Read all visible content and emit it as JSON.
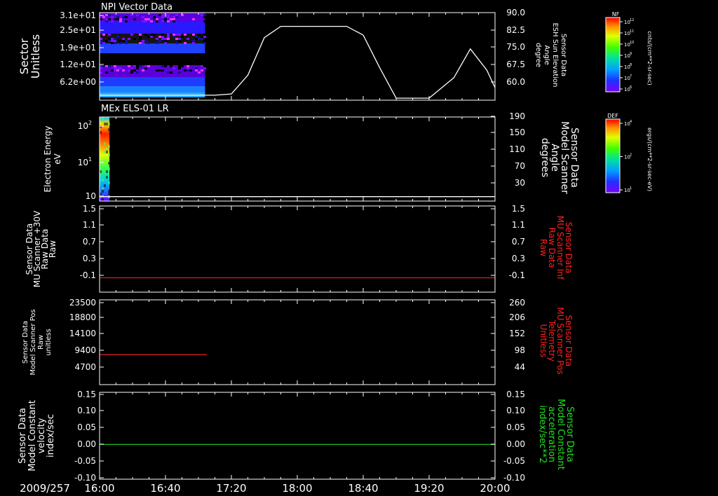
{
  "chart_data": {
    "date_label": "2009/257",
    "time_axis": {
      "start": "16:00",
      "end": "20:00",
      "tick_labels": [
        "16:00",
        "16:40",
        "17:20",
        "18:00",
        "18:40",
        "19:20",
        "20:00"
      ]
    },
    "panels": [
      {
        "id": "p1",
        "type": "heatmap",
        "title": "NPI Vector Data",
        "left_axis": {
          "label_lines": [
            "Sector",
            "Unitless"
          ],
          "tick_labels": [
            "3.1e+01",
            "2.5e+01",
            "1.9e+01",
            "1.2e+01",
            "6.2e+00"
          ],
          "range": [
            0,
            31
          ]
        },
        "right_axis": {
          "label_lines": [
            "Sensor Data",
            "ESH Sun Elevation",
            "Angle",
            "degree"
          ],
          "tick_labels": [
            "90.0",
            "82.5",
            "75.0",
            "67.5",
            "60.0"
          ],
          "range": [
            55,
            90
          ],
          "color": "#ffffff"
        },
        "heatmap_extent": {
          "x": [
            "16:00",
            "17:04"
          ]
        },
        "line_series": {
          "name": "ESH Sun Elevation Angle",
          "color": "#ffffff",
          "points": [
            [
              "16:00",
              57.0
            ],
            [
              "17:10",
              57.0
            ],
            [
              "17:20",
              57.5
            ],
            [
              "17:30",
              65
            ],
            [
              "17:40",
              80
            ],
            [
              "17:50",
              84.5
            ],
            [
              "18:30",
              84.5
            ],
            [
              "18:40",
              81
            ],
            [
              "18:50",
              68
            ],
            [
              "19:00",
              55.8
            ],
            [
              "19:20",
              55.8
            ],
            [
              "19:35",
              64
            ],
            [
              "19:45",
              75.5
            ],
            [
              "19:55",
              67
            ],
            [
              "20:00",
              60
            ]
          ]
        }
      },
      {
        "id": "p2",
        "type": "heatmap",
        "title": "MEx ELS-01 LR",
        "left_axis": {
          "label_lines": [
            "Electron Energy",
            "eV"
          ],
          "tick_labels": [
            "10",
            "10",
            "10"
          ],
          "tick_exponents": [
            "2",
            "1",
            ""
          ],
          "scale": "log"
        },
        "right_axis": {
          "label_lines": [
            "Sensor Data",
            "Model Scanner",
            "Angle",
            "degrees"
          ],
          "tick_labels": [
            "190",
            "150",
            "110",
            "70",
            "30"
          ],
          "range": [
            0,
            190
          ],
          "color": "#ffffff"
        },
        "heatmap_extent": {
          "x": [
            "16:00",
            "16:06"
          ]
        },
        "line_series": {
          "name": "Model Scanner Angle",
          "color": "#ffffff",
          "points": [
            [
              "16:00",
              10
            ],
            [
              "20:00",
              10
            ]
          ]
        }
      },
      {
        "id": "p3",
        "type": "line",
        "left_axis": {
          "label_lines": [
            "Sensor Data",
            "MU Scanner +30V",
            "Raw Data",
            "Raw"
          ],
          "tick_labels": [
            "1.5",
            "1.1",
            "0.7",
            "0.3",
            "-0.1"
          ],
          "range": [
            -0.3,
            1.5
          ]
        },
        "right_axis": {
          "label_lines": [
            "Sensor Data",
            "MU Scanner Inf",
            "Raw Data",
            "Raw"
          ],
          "tick_labels": [
            "1.5",
            "1.1",
            "0.7",
            "0.3",
            "-0.1"
          ],
          "range": [
            -0.3,
            1.5
          ],
          "color": "#ff2020"
        },
        "line_series": {
          "name": "MU Scanner Inf Raw Data",
          "color": "#d02020",
          "points": [
            [
              "16:00",
              0.0
            ],
            [
              "20:00",
              0.0
            ]
          ]
        }
      },
      {
        "id": "p4",
        "type": "line",
        "left_axis": {
          "label_lines": [
            "Sensor Data",
            "Model Scanner Pos",
            "Raw",
            "unitless"
          ],
          "tick_labels": [
            "23500",
            "18800",
            "14100",
            "9400",
            "4700"
          ],
          "range": [
            0,
            23500
          ]
        },
        "right_axis": {
          "label_lines": [
            "Sensor Data",
            "MU Scanner Pos",
            "Telemetry",
            "Unitless"
          ],
          "tick_labels": [
            "260",
            "206",
            "152",
            "98",
            "44"
          ],
          "range": [
            0,
            260
          ],
          "color": "#ff2020"
        },
        "line_series": {
          "name": "MU Scanner Pos Telemetry",
          "color": "#d02020",
          "points": [
            [
              "16:00",
              8300
            ],
            [
              "17:05",
              8300
            ]
          ]
        }
      },
      {
        "id": "p5",
        "type": "line",
        "left_axis": {
          "label_lines": [
            "Sensor Data",
            "Model Constant",
            "velocity",
            "index/sec"
          ],
          "tick_labels": [
            "0.15",
            "0.10",
            "0.05",
            "0.00",
            "-0.05",
            "-0.10"
          ],
          "range": [
            -0.1,
            0.15
          ]
        },
        "right_axis": {
          "label_lines": [
            "Sensor Data",
            "Model Constant",
            "acceleration",
            "index/sec**2"
          ],
          "tick_labels": [
            "0.15",
            "0.10",
            "0.05",
            "0.00",
            "-0.05",
            "-0.10"
          ],
          "range": [
            -0.1,
            0.15
          ],
          "color": "#20e020"
        },
        "line_series": {
          "name": "Model Constant acceleration",
          "color": "#20c020",
          "points": [
            [
              "16:00",
              0.0
            ],
            [
              "20:00",
              0.0
            ]
          ]
        }
      }
    ],
    "colorbars": [
      {
        "id": "cb1",
        "label": "NF",
        "unit": "cnts/(cm**2-sr-sec)",
        "tick_labels": [
          "10",
          "10",
          "10",
          "10",
          "10",
          "10",
          "10"
        ],
        "tick_exponents": [
          "12",
          "11",
          "10",
          "9",
          "8",
          "7",
          "6"
        ]
      },
      {
        "id": "cb2",
        "label": "DEF",
        "unit": "ergs/(cm**2-sr-sec-eV)",
        "tick_labels": [
          "10",
          "10",
          "10"
        ],
        "tick_exponents": [
          "4",
          "2",
          "1"
        ]
      }
    ]
  }
}
